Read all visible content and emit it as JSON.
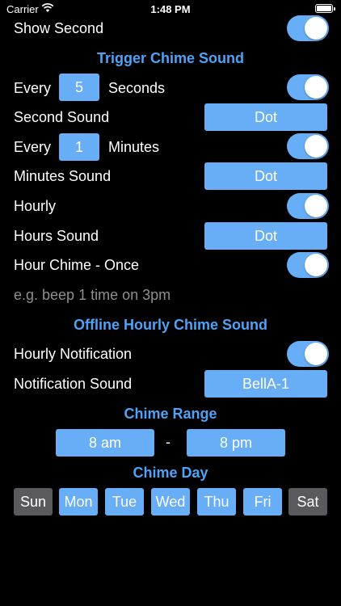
{
  "status_bar": {
    "carrier": "Carrier",
    "time": "1:48 PM",
    "battery_percent": 100
  },
  "show_second": {
    "label": "Show Second",
    "on": true
  },
  "trigger_section": {
    "title": "Trigger Chime Sound",
    "every_seconds": {
      "prefix": "Every",
      "value": "5",
      "unit": "Seconds",
      "on": true
    },
    "second_sound": {
      "label": "Second Sound",
      "value": "Dot"
    },
    "every_minutes": {
      "prefix": "Every",
      "value": "1",
      "unit": "Minutes",
      "on": true
    },
    "minutes_sound": {
      "label": "Minutes Sound",
      "value": "Dot"
    },
    "hourly": {
      "label": "Hourly",
      "on": true
    },
    "hours_sound": {
      "label": "Hours Sound",
      "value": "Dot"
    },
    "hour_chime_once": {
      "label": "Hour Chime - Once",
      "on": true
    },
    "hint": "e.g. beep 1 time on 3pm"
  },
  "offline_section": {
    "title": "Offline Hourly Chime Sound",
    "hourly_notification": {
      "label": "Hourly Notification",
      "on": true
    },
    "notification_sound": {
      "label": "Notification Sound",
      "value": "BellA-1"
    }
  },
  "chime_range": {
    "title": "Chime Range",
    "start": "8 am",
    "separator": "-",
    "end": "8 pm"
  },
  "chime_day": {
    "title": "Chime Day",
    "days": [
      {
        "label": "Sun",
        "selected": false
      },
      {
        "label": "Mon",
        "selected": true
      },
      {
        "label": "Tue",
        "selected": true
      },
      {
        "label": "Wed",
        "selected": true
      },
      {
        "label": "Thu",
        "selected": true
      },
      {
        "label": "Fri",
        "selected": true
      },
      {
        "label": "Sat",
        "selected": false
      }
    ]
  },
  "colors": {
    "accent": "#67aef6",
    "header": "#4fa3f7",
    "day_off": "#5a5a5e",
    "hint": "#8e8e93",
    "background": "#000000"
  }
}
